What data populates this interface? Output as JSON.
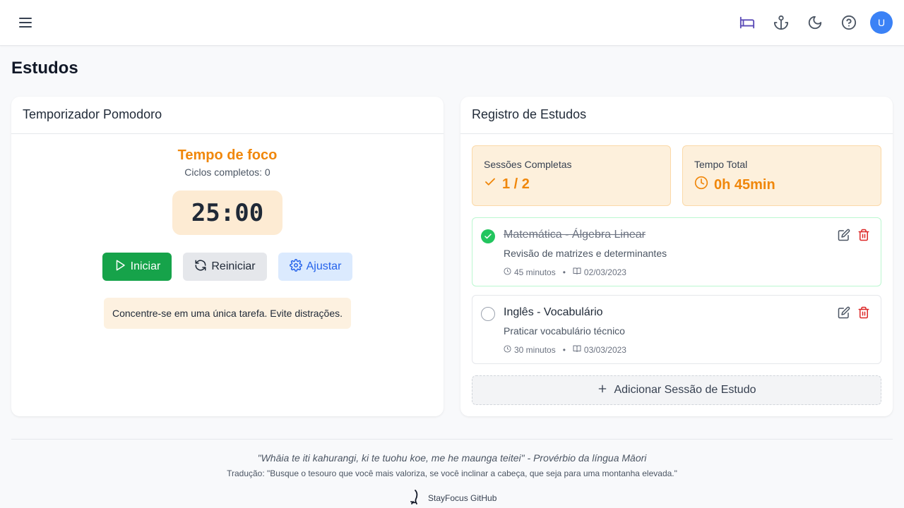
{
  "header": {
    "icons": [
      "menu-icon",
      "bed-icon",
      "anchor-icon",
      "moon-icon",
      "help-icon"
    ],
    "accent_icon_color": "#5b4bb7",
    "avatar_initial": "U",
    "avatar_color": "#3b82f6"
  },
  "page": {
    "title": "Estudos"
  },
  "pomodoro": {
    "card_title": "Temporizador Pomodoro",
    "mode_label": "Tempo de foco",
    "cycles_label": "Ciclos completos: 0",
    "timer": "25:00",
    "buttons": {
      "start": "Iniciar",
      "reset": "Reiniciar",
      "adjust": "Ajustar"
    },
    "tip": "Concentre-se em uma única tarefa. Evite distrações.",
    "accent_color": "#f0870b"
  },
  "log": {
    "card_title": "Registro de Estudos",
    "stats": {
      "sessions_label": "Sessões Completas",
      "sessions_value": "1 / 2",
      "time_label": "Tempo Total",
      "time_value": "0h 45min"
    },
    "sessions": [
      {
        "title": "Matemática - Álgebra Linear",
        "description": "Revisão de matrizes e determinantes",
        "duration": "45 minutos",
        "date": "02/03/2023",
        "completed": true
      },
      {
        "title": "Inglês - Vocabulário",
        "description": "Praticar vocabulário técnico",
        "duration": "30 minutos",
        "date": "03/03/2023",
        "completed": false
      }
    ],
    "add_button": "Adicionar Sessão de Estudo"
  },
  "footer": {
    "quote": "\"Whāia te iti kahurangi, ki te tuohu koe, me he maunga teitei\" - Provérbio da língua Māori",
    "translation": "Tradução: \"Busque o tesouro que você mais valoriza, se você inclinar a cabeça, que seja para uma montanha elevada.\"",
    "github_link": "StayFocus GitHub"
  }
}
